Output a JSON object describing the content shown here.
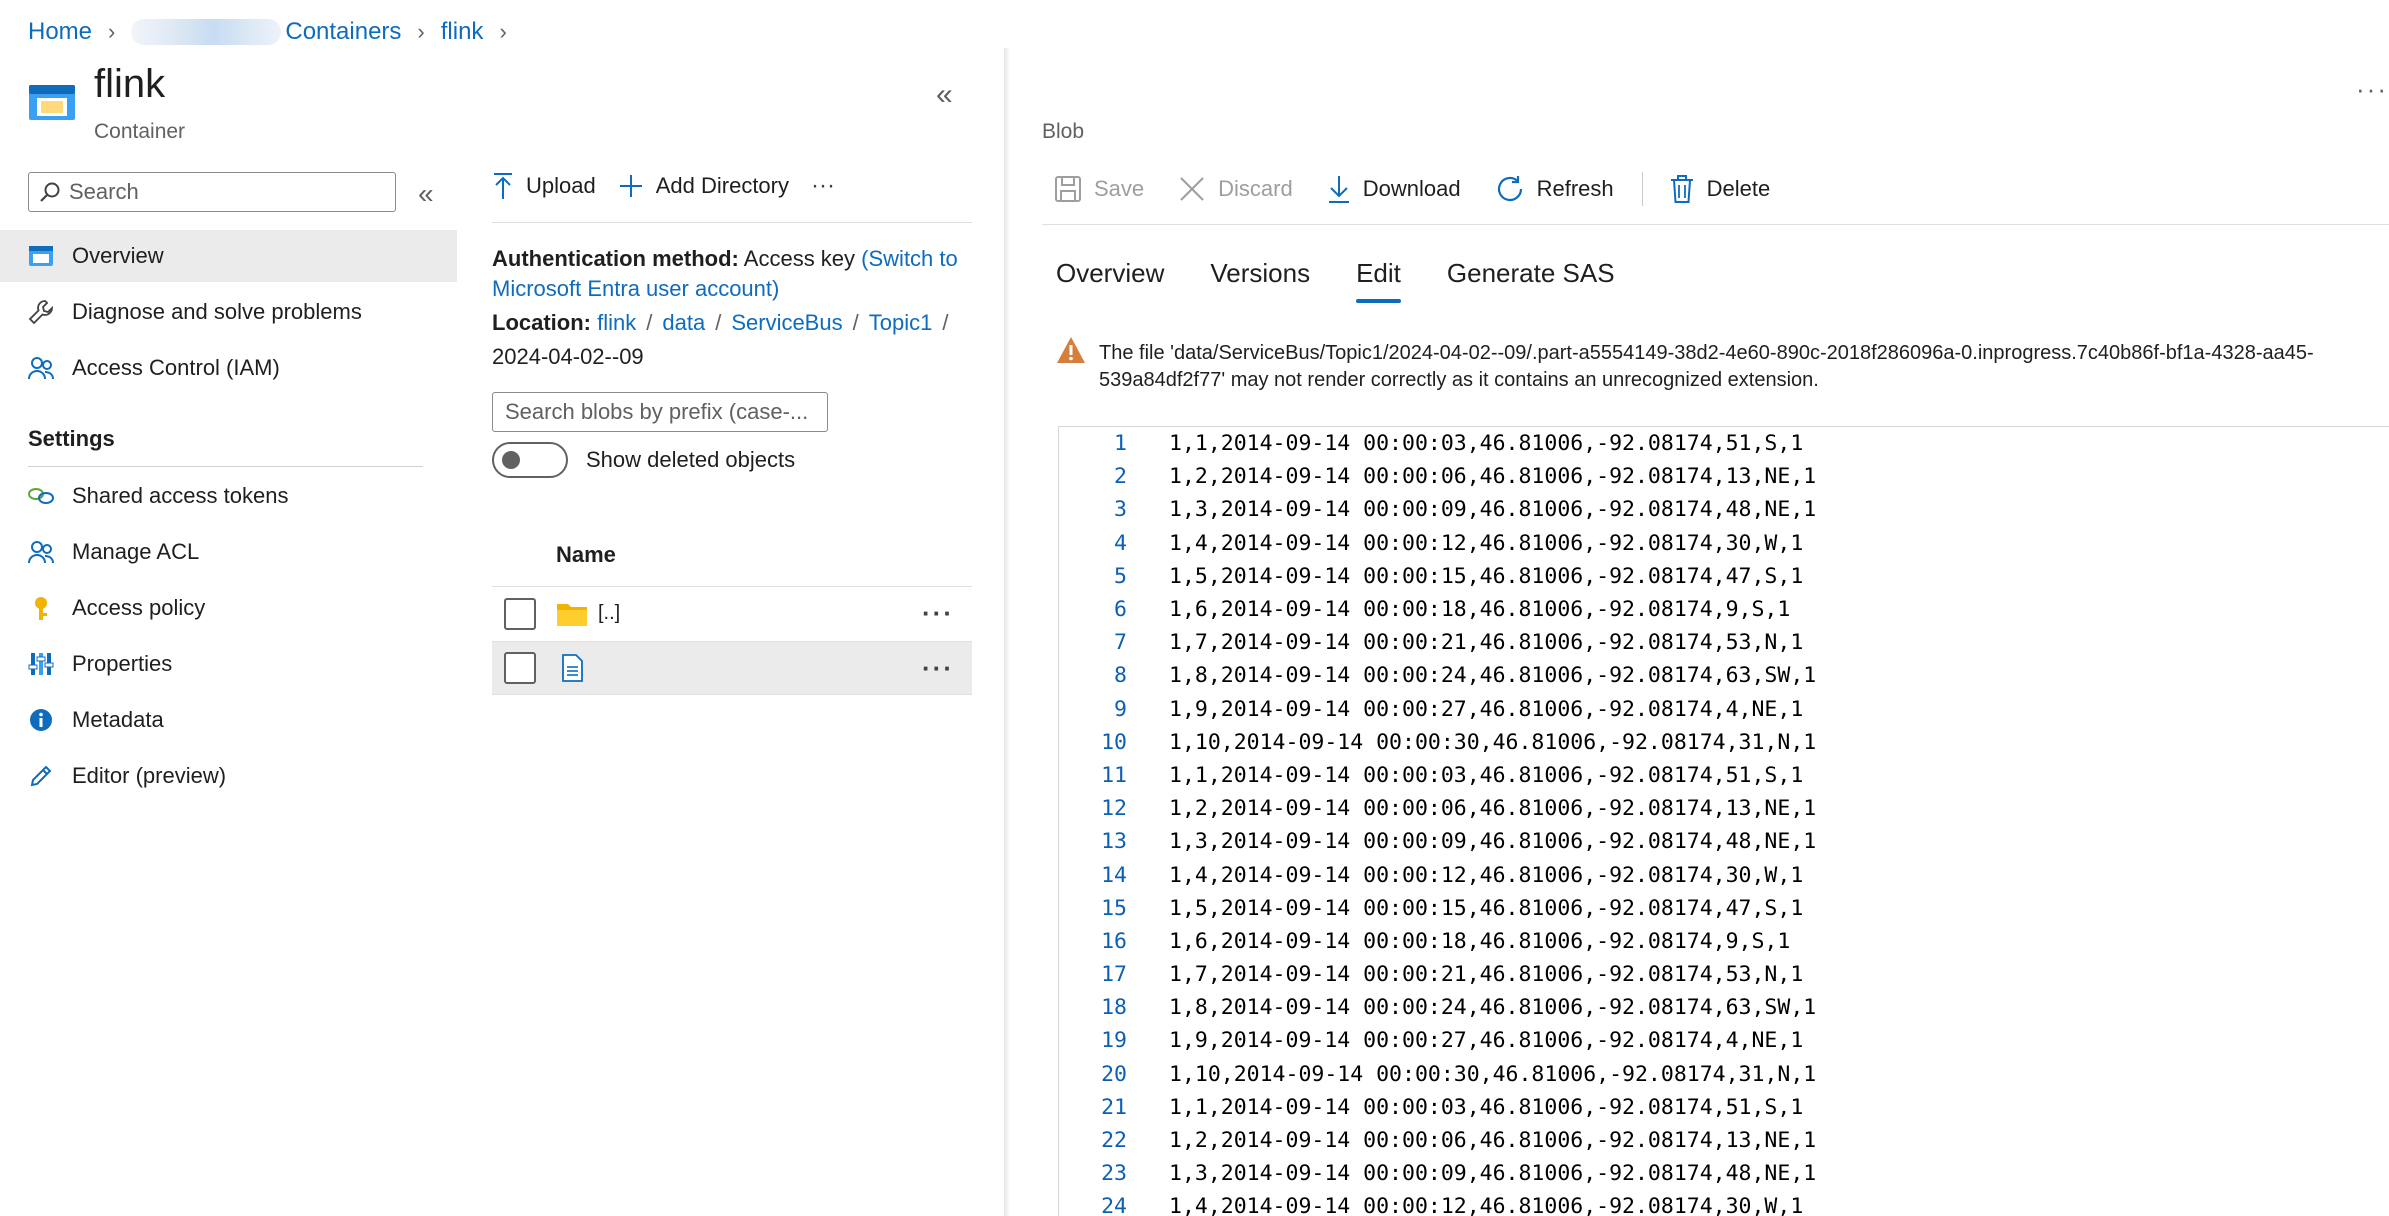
{
  "breadcrumb": {
    "home": "Home",
    "containers": "Containers",
    "container": "flink"
  },
  "resource": {
    "title": "flink",
    "subtitle": "Container"
  },
  "nav": {
    "search_placeholder": "Search",
    "items": [
      {
        "label": "Overview",
        "icon": "overview-icon"
      },
      {
        "label": "Diagnose and solve problems",
        "icon": "wrench-icon"
      },
      {
        "label": "Access Control (IAM)",
        "icon": "people-icon"
      }
    ],
    "settings_heading": "Settings",
    "settings_items": [
      {
        "label": "Shared access tokens",
        "icon": "link-icon"
      },
      {
        "label": "Manage ACL",
        "icon": "people-icon"
      },
      {
        "label": "Access policy",
        "icon": "key-icon"
      },
      {
        "label": "Properties",
        "icon": "properties-icon"
      },
      {
        "label": "Metadata",
        "icon": "info-icon"
      },
      {
        "label": "Editor (preview)",
        "icon": "pencil-icon"
      }
    ]
  },
  "middle": {
    "toolbar": {
      "upload": "Upload",
      "add_directory": "Add Directory",
      "more": "···"
    },
    "auth_label": "Authentication method:",
    "auth_value": "Access key",
    "auth_link": "(Switch to Microsoft Entra user account)",
    "location_label": "Location:",
    "location_path": [
      "flink",
      "data",
      "ServiceBus",
      "Topic1"
    ],
    "location_sep": "/",
    "location_current": "2024-04-02--09",
    "blob_search_placeholder": "Search blobs by prefix (case-...",
    "show_deleted": "Show deleted objects",
    "column_name": "Name",
    "rows": [
      {
        "name": "[..]",
        "type": "folder"
      },
      {
        "name": "",
        "type": "file"
      }
    ]
  },
  "blob": {
    "label": "Blob",
    "toolbar": {
      "save": "Save",
      "discard": "Discard",
      "download": "Download",
      "refresh": "Refresh",
      "delete": "Delete"
    },
    "tabs": [
      "Overview",
      "Versions",
      "Edit",
      "Generate SAS"
    ],
    "active_tab": "Edit",
    "warning": "The file 'data/ServiceBus/Topic1/2024-04-02--09/.part-a5554149-38d2-4e60-890c-2018f286096a-0.inprogress.7c40b86f-bf1a-4328-aa45-539a84df2f77' may not render correctly as it contains an unrecognized extension.",
    "lines": [
      "1,1,2014-09-14 00:00:03,46.81006,-92.08174,51,S,1",
      "1,2,2014-09-14 00:00:06,46.81006,-92.08174,13,NE,1",
      "1,3,2014-09-14 00:00:09,46.81006,-92.08174,48,NE,1",
      "1,4,2014-09-14 00:00:12,46.81006,-92.08174,30,W,1",
      "1,5,2014-09-14 00:00:15,46.81006,-92.08174,47,S,1",
      "1,6,2014-09-14 00:00:18,46.81006,-92.08174,9,S,1",
      "1,7,2014-09-14 00:00:21,46.81006,-92.08174,53,N,1",
      "1,8,2014-09-14 00:00:24,46.81006,-92.08174,63,SW,1",
      "1,9,2014-09-14 00:00:27,46.81006,-92.08174,4,NE,1",
      "1,10,2014-09-14 00:00:30,46.81006,-92.08174,31,N,1",
      "1,1,2014-09-14 00:00:03,46.81006,-92.08174,51,S,1",
      "1,2,2014-09-14 00:00:06,46.81006,-92.08174,13,NE,1",
      "1,3,2014-09-14 00:00:09,46.81006,-92.08174,48,NE,1",
      "1,4,2014-09-14 00:00:12,46.81006,-92.08174,30,W,1",
      "1,5,2014-09-14 00:00:15,46.81006,-92.08174,47,S,1",
      "1,6,2014-09-14 00:00:18,46.81006,-92.08174,9,S,1",
      "1,7,2014-09-14 00:00:21,46.81006,-92.08174,53,N,1",
      "1,8,2014-09-14 00:00:24,46.81006,-92.08174,63,SW,1",
      "1,9,2014-09-14 00:00:27,46.81006,-92.08174,4,NE,1",
      "1,10,2014-09-14 00:00:30,46.81006,-92.08174,31,N,1",
      "1,1,2014-09-14 00:00:03,46.81006,-92.08174,51,S,1",
      "1,2,2014-09-14 00:00:06,46.81006,-92.08174,13,NE,1",
      "1,3,2014-09-14 00:00:09,46.81006,-92.08174,48,NE,1",
      "1,4,2014-09-14 00:00:12,46.81006,-92.08174,30,W,1"
    ]
  },
  "colors": {
    "link": "#0f6cbd",
    "accent": "#0f6cbd",
    "warning": "#d67f3c",
    "selected_bg": "#ebebeb"
  }
}
